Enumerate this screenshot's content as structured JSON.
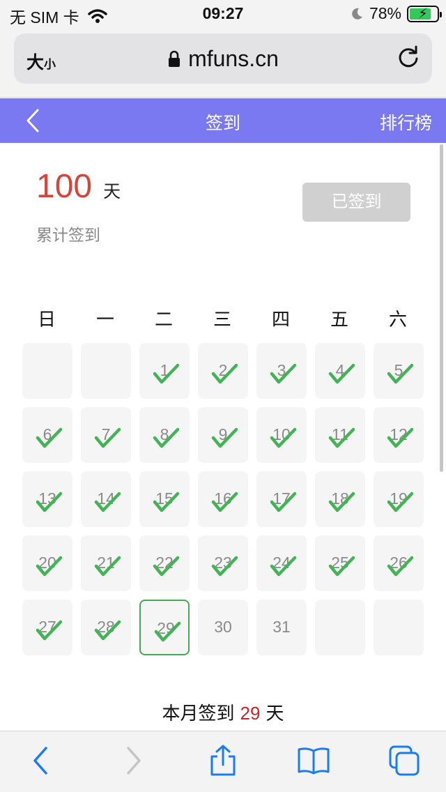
{
  "status_bar": {
    "carrier": "无 SIM 卡",
    "time": "09:27",
    "battery_percent": "78%",
    "battery_level": 0.78,
    "icons": [
      "wifi-icon",
      "moon-icon",
      "battery-charging-icon"
    ]
  },
  "browser": {
    "text_size": "大",
    "text_size_small": "小",
    "url": "mfuns.cn",
    "icons": [
      "lock-icon",
      "reload-icon"
    ]
  },
  "app_header": {
    "title": "签到",
    "right_action": "排行榜",
    "background": "#7b79f2"
  },
  "summary": {
    "total_days": "100",
    "unit": "天",
    "label": "累计签到",
    "button_label": "已签到"
  },
  "calendar": {
    "weekdays": [
      "日",
      "一",
      "二",
      "三",
      "四",
      "五",
      "六"
    ],
    "leading_blanks": 2,
    "days": 31,
    "checked_through": 29,
    "today": 29,
    "check_color": "#43b455"
  },
  "month_summary": {
    "prefix": "本月签到",
    "count": "29",
    "suffix": "天"
  },
  "toolbar": {
    "icons": [
      "back-arrow-icon",
      "forward-arrow-icon",
      "share-icon",
      "bookmarks-icon",
      "tabs-icon"
    ]
  }
}
